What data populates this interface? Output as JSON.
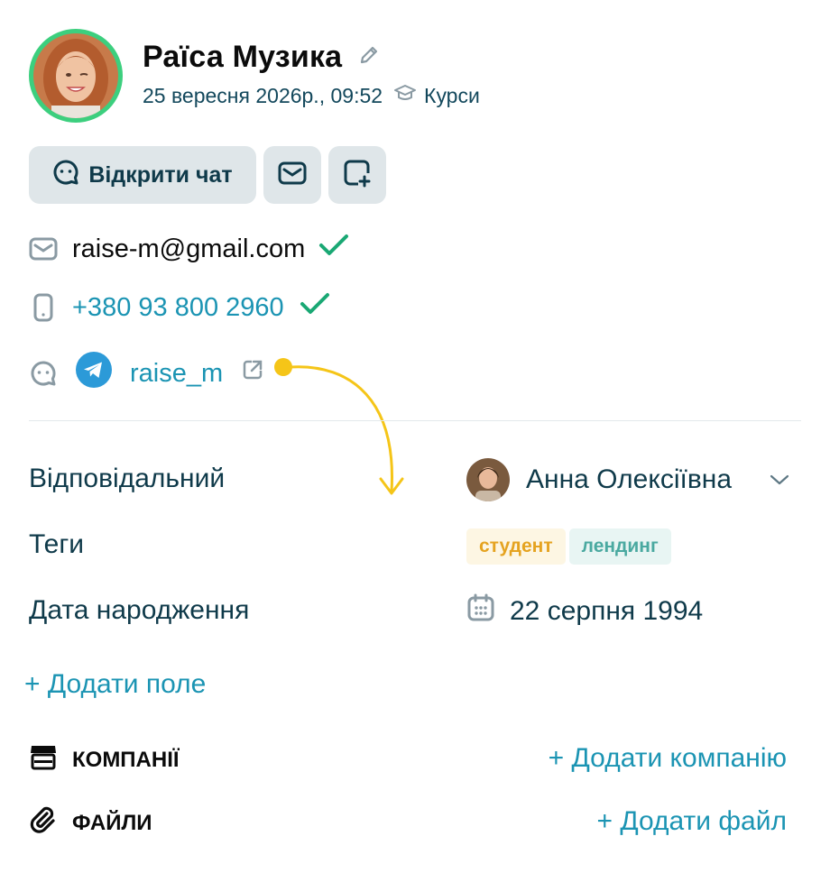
{
  "contact": {
    "name": "Раїса Музика",
    "created_at": "25 вересня 2026р., 09:52",
    "source": "Курси"
  },
  "actions": {
    "open_chat_label": "Відкрити чат"
  },
  "channels": {
    "email": "raise-m@gmail.com",
    "phone": "+380 93 800 2960",
    "telegram": "raise_m"
  },
  "fields": {
    "responsible_label": "Відповідальний",
    "responsible_value": "Анна Олексіївна",
    "tags_label": "Теги",
    "tags": [
      "студент",
      "лендинг"
    ],
    "birthday_label": "Дата народження",
    "birthday_value": "22 серпня 1994"
  },
  "add_field_label": "+ Додати поле",
  "sections": {
    "companies_title": "КОМПАНІЇ",
    "add_company_label": "+ Додати компанію",
    "files_title": "ФАЙЛИ",
    "add_file_label": "+ Додати файл"
  },
  "colors": {
    "accent": "#1b94b3",
    "verified": "#1aa874",
    "avatar_ring": "#3ccf7e",
    "annotation": "#f5c518"
  }
}
